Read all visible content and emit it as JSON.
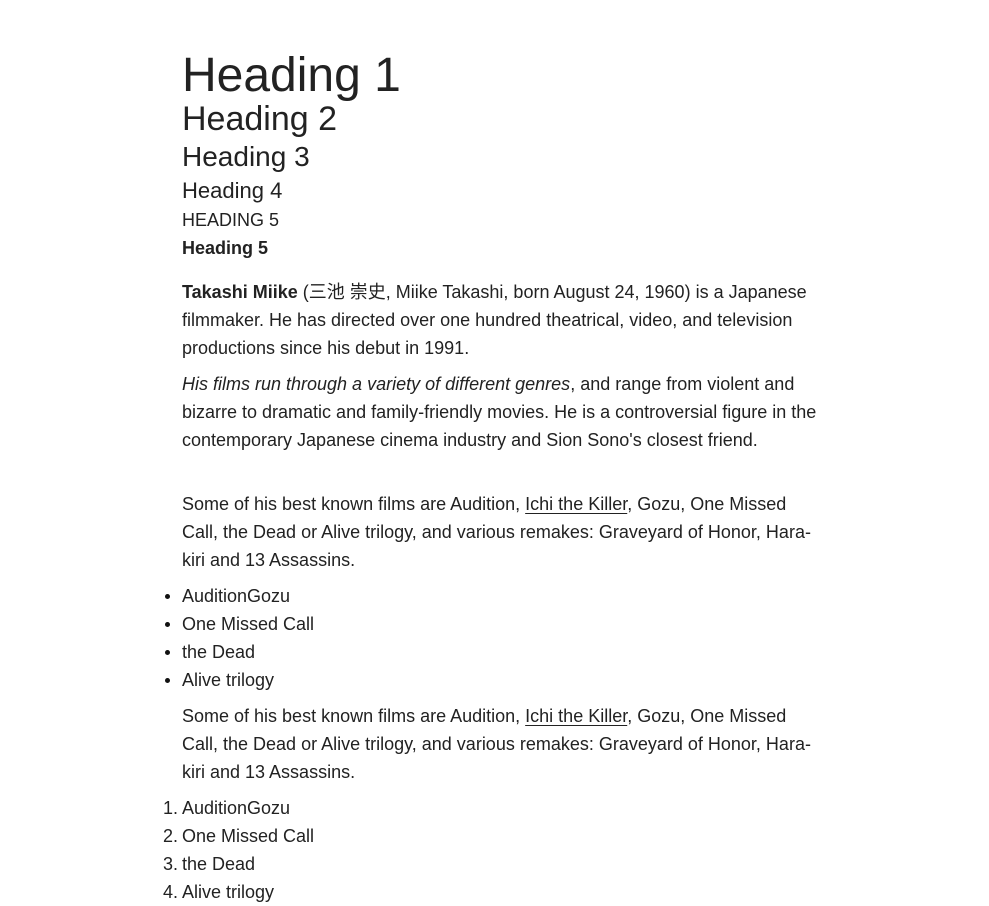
{
  "headings": {
    "h1": "Heading 1",
    "h2": "Heading 2",
    "h3": "Heading 3",
    "h4": "Heading 4",
    "h5": "HEADING 5",
    "h6": "Heading 5"
  },
  "paragraph1": {
    "bold": "Takashi Miike",
    "text": " (三池 崇史, Miike Takashi, born August 24, 1960) is a Japanese filmmaker. He has directed over one hundred theatrical, video, and television productions since his debut in 1991."
  },
  "paragraph2": {
    "italic": "His films run through a variety of different genres",
    "text": ", and range from violent and bizarre to dramatic and family-friendly movies. He is a controversial figure in the contemporary Japanese cinema industry and Sion Sono's closest friend."
  },
  "paragraph3": {
    "before": "Some of his best known films are Audition, ",
    "link": "Ichi the Killer",
    "after": ", Gozu, One Missed Call, the Dead or Alive trilogy, and various remakes: Graveyard of Honor, Hara-kiri and 13 Assassins."
  },
  "unordered_list": [
    "AuditionGozu",
    "One Missed Call",
    "the Dead",
    "Alive trilogy"
  ],
  "paragraph4": {
    "before": "Some of his best known films are Audition, ",
    "link": "Ichi the Killer",
    "after": ", Gozu, One Missed Call, the Dead or Alive trilogy, and various remakes: Graveyard of Honor, Hara-kiri and 13 Assassins."
  },
  "ordered_list": {
    "numbers": [
      "1.",
      "2.",
      "3.",
      "4."
    ],
    "items": [
      "AuditionGozu",
      "One Missed Call",
      "the Dead",
      "Alive trilogy"
    ]
  }
}
